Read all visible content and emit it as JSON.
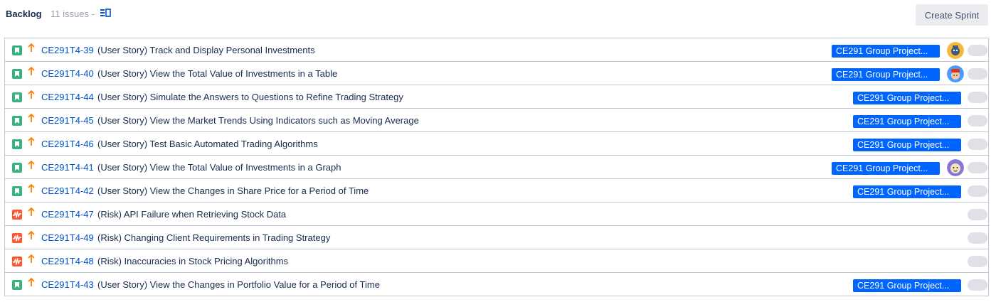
{
  "backlog": {
    "title": "Backlog",
    "count": "11 issues -",
    "create_sprint_label": "Create Sprint"
  },
  "colors": {
    "story": "#36b37e",
    "risk": "#ff5630",
    "priority": "#ff7f00",
    "link": "#0052cc",
    "epic_badge": "#0065ff"
  },
  "issues": [
    {
      "key": "CE291T4-39",
      "summary": "(User Story) Track and Display Personal Investments",
      "type": "story",
      "epic": "CE291 Group Project...",
      "avatar": "avatar-yellow"
    },
    {
      "key": "CE291T4-40",
      "summary": "(User Story) View the Total Value of Investments in a Table",
      "type": "story",
      "epic": "CE291 Group Project...",
      "avatar": "avatar-blue"
    },
    {
      "key": "CE291T4-44",
      "summary": "(User Story) Simulate the Answers to Questions to Refine Trading Strategy",
      "type": "story",
      "epic": "CE291 Group Project...",
      "avatar": ""
    },
    {
      "key": "CE291T4-45",
      "summary": "(User Story) View the Market Trends Using Indicators such as Moving Average",
      "type": "story",
      "epic": "CE291 Group Project...",
      "avatar": ""
    },
    {
      "key": "CE291T4-46",
      "summary": "(User Story) Test Basic Automated Trading Algorithms",
      "type": "story",
      "epic": "CE291 Group Project...",
      "avatar": ""
    },
    {
      "key": "CE291T4-41",
      "summary": "(User Story) View the Total Value of Investments in a Graph",
      "type": "story",
      "epic": "CE291 Group Project...",
      "avatar": "avatar-purple"
    },
    {
      "key": "CE291T4-42",
      "summary": "(User Story) View the Changes in Share Price for a Period of Time",
      "type": "story",
      "epic": "CE291 Group Project...",
      "avatar": ""
    },
    {
      "key": "CE291T4-47",
      "summary": "(Risk) API Failure when Retrieving Stock Data",
      "type": "risk",
      "epic": "",
      "avatar": ""
    },
    {
      "key": "CE291T4-49",
      "summary": "(Risk) Changing Client Requirements in Trading Strategy",
      "type": "risk",
      "epic": "",
      "avatar": ""
    },
    {
      "key": "CE291T4-48",
      "summary": "(Risk) Inaccuracies in Stock Pricing Algorithms",
      "type": "risk",
      "epic": "",
      "avatar": ""
    },
    {
      "key": "CE291T4-43",
      "summary": "(User Story) View the Changes in Portfolio Value for a Period of Time",
      "type": "story",
      "epic": "CE291 Group Project...",
      "avatar": ""
    }
  ]
}
